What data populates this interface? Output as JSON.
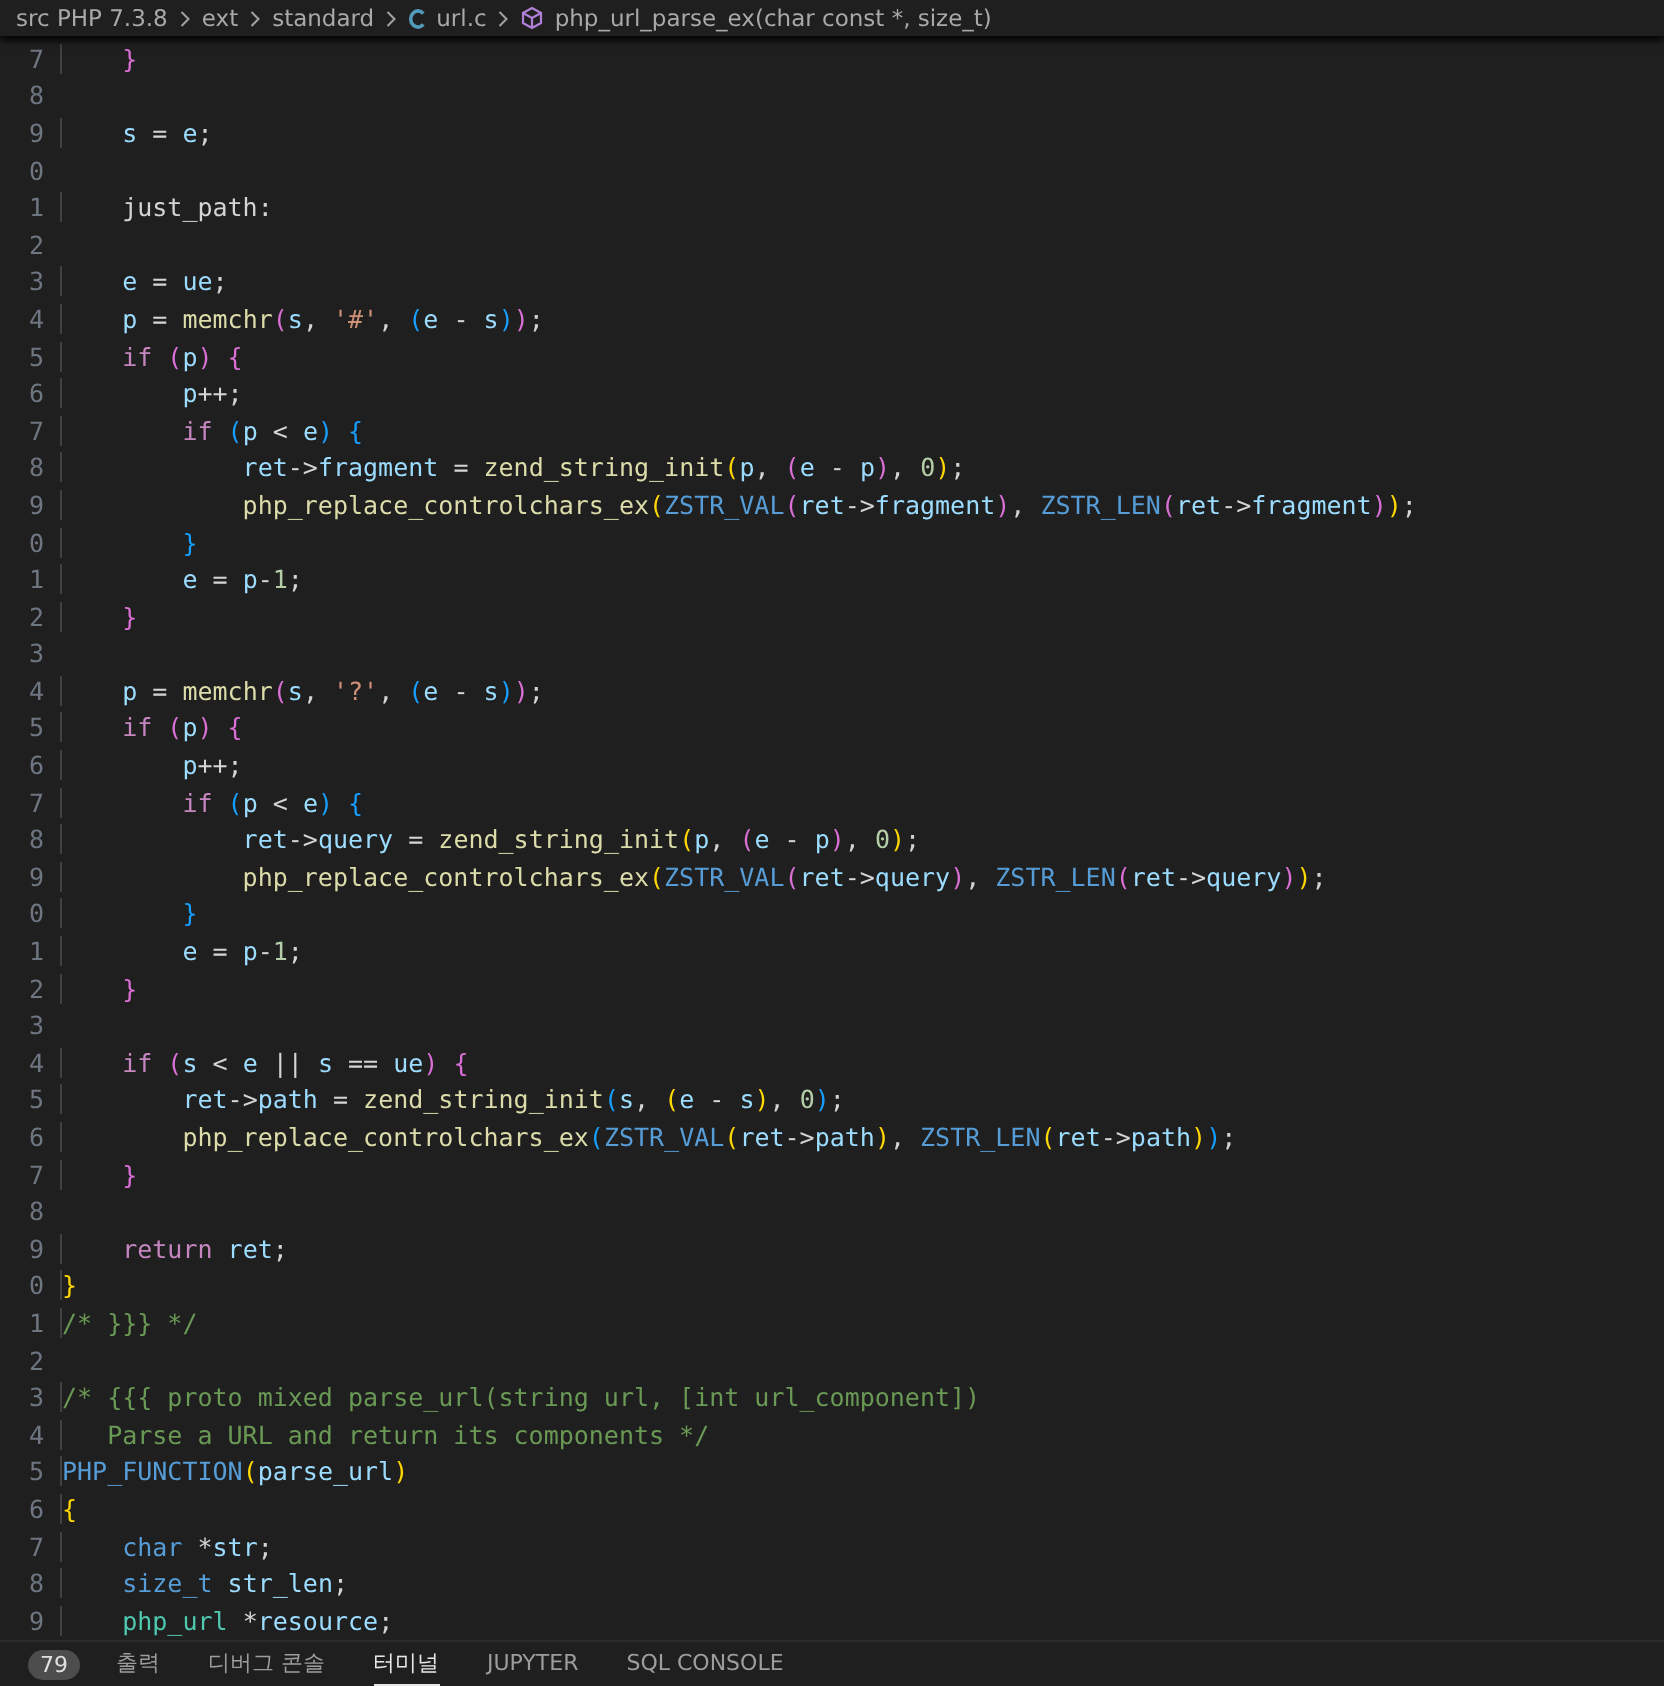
{
  "breadcrumb": [
    {
      "label": "src PHP 7.3.8"
    },
    {
      "label": "ext"
    },
    {
      "label": "standard"
    },
    {
      "label": "url.c"
    },
    {
      "label": "php_url_parse_ex(char const *, size_t)"
    }
  ],
  "editor": {
    "lines": [
      {
        "num": "7",
        "tokens": [
          {
            "kind": "b2",
            "text": "    }"
          }
        ]
      },
      {
        "num": "8"
      },
      {
        "num": "9",
        "tokens": [
          {
            "kind": "var",
            "text": "    s"
          },
          {
            "kind": "plain",
            "text": " = "
          },
          {
            "kind": "var",
            "text": "e"
          },
          {
            "kind": "plain",
            "text": ";"
          }
        ]
      },
      {
        "num": "0"
      },
      {
        "num": "1",
        "tokens": [
          {
            "kind": "plain",
            "text": "    just_path:"
          }
        ]
      },
      {
        "num": "2"
      },
      {
        "num": "3",
        "tokens": [
          {
            "kind": "var",
            "text": "    e"
          },
          {
            "kind": "plain",
            "text": " = "
          },
          {
            "kind": "var",
            "text": "ue"
          },
          {
            "kind": "plain",
            "text": ";"
          }
        ]
      },
      {
        "num": "4",
        "tokens": [
          {
            "kind": "var",
            "text": "    p"
          },
          {
            "kind": "plain",
            "text": " = "
          },
          {
            "kind": "fn",
            "text": "memchr"
          },
          {
            "kind": "b2",
            "text": "("
          },
          {
            "kind": "var",
            "text": "s"
          },
          {
            "kind": "plain",
            "text": ", "
          },
          {
            "kind": "str",
            "text": "'#'"
          },
          {
            "kind": "plain",
            "text": ", "
          },
          {
            "kind": "b3",
            "text": "("
          },
          {
            "kind": "var",
            "text": "e"
          },
          {
            "kind": "plain",
            "text": " - "
          },
          {
            "kind": "var",
            "text": "s"
          },
          {
            "kind": "b3",
            "text": ")"
          },
          {
            "kind": "b2",
            "text": ")"
          },
          {
            "kind": "plain",
            "text": ";"
          }
        ]
      },
      {
        "num": "5",
        "tokens": [
          {
            "kind": "kw",
            "text": "    if"
          },
          {
            "kind": "b2",
            "text": " ("
          },
          {
            "kind": "var",
            "text": "p"
          },
          {
            "kind": "b2",
            "text": ") {"
          }
        ]
      },
      {
        "num": "6",
        "tokens": [
          {
            "kind": "var",
            "text": "        p"
          },
          {
            "kind": "plain",
            "text": "++;"
          }
        ]
      },
      {
        "num": "7",
        "tokens": [
          {
            "kind": "kw",
            "text": "        if"
          },
          {
            "kind": "b3",
            "text": " ("
          },
          {
            "kind": "var",
            "text": "p"
          },
          {
            "kind": "plain",
            "text": " < "
          },
          {
            "kind": "var",
            "text": "e"
          },
          {
            "kind": "b3",
            "text": ") {"
          }
        ]
      },
      {
        "num": "8",
        "tokens": [
          {
            "kind": "var",
            "text": "            ret"
          },
          {
            "kind": "plain",
            "text": "->"
          },
          {
            "kind": "var",
            "text": "fragment"
          },
          {
            "kind": "plain",
            "text": " = "
          },
          {
            "kind": "fn",
            "text": "zend_string_init"
          },
          {
            "kind": "b1",
            "text": "("
          },
          {
            "kind": "var",
            "text": "p"
          },
          {
            "kind": "plain",
            "text": ", "
          },
          {
            "kind": "b2",
            "text": "("
          },
          {
            "kind": "var",
            "text": "e"
          },
          {
            "kind": "plain",
            "text": " - "
          },
          {
            "kind": "var",
            "text": "p"
          },
          {
            "kind": "b2",
            "text": ")"
          },
          {
            "kind": "plain",
            "text": ", "
          },
          {
            "kind": "num",
            "text": "0"
          },
          {
            "kind": "b1",
            "text": ")"
          },
          {
            "kind": "plain",
            "text": ";"
          }
        ]
      },
      {
        "num": "9",
        "tokens": [
          {
            "kind": "fn",
            "text": "            php_replace_controlchars_ex"
          },
          {
            "kind": "b1",
            "text": "("
          },
          {
            "kind": "macro",
            "text": "ZSTR_VAL"
          },
          {
            "kind": "b2",
            "text": "("
          },
          {
            "kind": "var",
            "text": "ret"
          },
          {
            "kind": "plain",
            "text": "->"
          },
          {
            "kind": "var",
            "text": "fragment"
          },
          {
            "kind": "b2",
            "text": ")"
          },
          {
            "kind": "plain",
            "text": ", "
          },
          {
            "kind": "macro",
            "text": "ZSTR_LEN"
          },
          {
            "kind": "b2",
            "text": "("
          },
          {
            "kind": "var",
            "text": "ret"
          },
          {
            "kind": "plain",
            "text": "->"
          },
          {
            "kind": "var",
            "text": "fragment"
          },
          {
            "kind": "b2",
            "text": ")"
          },
          {
            "kind": "b1",
            "text": ")"
          },
          {
            "kind": "plain",
            "text": ";"
          }
        ]
      },
      {
        "num": "0",
        "tokens": [
          {
            "kind": "b3",
            "text": "        }"
          }
        ]
      },
      {
        "num": "1",
        "tokens": [
          {
            "kind": "var",
            "text": "        e"
          },
          {
            "kind": "plain",
            "text": " = "
          },
          {
            "kind": "var",
            "text": "p"
          },
          {
            "kind": "plain",
            "text": "-"
          },
          {
            "kind": "num",
            "text": "1"
          },
          {
            "kind": "plain",
            "text": ";"
          }
        ]
      },
      {
        "num": "2",
        "tokens": [
          {
            "kind": "b2",
            "text": "    }"
          }
        ]
      },
      {
        "num": "3"
      },
      {
        "num": "4",
        "tokens": [
          {
            "kind": "var",
            "text": "    p"
          },
          {
            "kind": "plain",
            "text": " = "
          },
          {
            "kind": "fn",
            "text": "memchr"
          },
          {
            "kind": "b2",
            "text": "("
          },
          {
            "kind": "var",
            "text": "s"
          },
          {
            "kind": "plain",
            "text": ", "
          },
          {
            "kind": "str",
            "text": "'?'"
          },
          {
            "kind": "plain",
            "text": ", "
          },
          {
            "kind": "b3",
            "text": "("
          },
          {
            "kind": "var",
            "text": "e"
          },
          {
            "kind": "plain",
            "text": " - "
          },
          {
            "kind": "var",
            "text": "s"
          },
          {
            "kind": "b3",
            "text": ")"
          },
          {
            "kind": "b2",
            "text": ")"
          },
          {
            "kind": "plain",
            "text": ";"
          }
        ]
      },
      {
        "num": "5",
        "tokens": [
          {
            "kind": "kw",
            "text": "    if"
          },
          {
            "kind": "b2",
            "text": " ("
          },
          {
            "kind": "var",
            "text": "p"
          },
          {
            "kind": "b2",
            "text": ") {"
          }
        ]
      },
      {
        "num": "6",
        "tokens": [
          {
            "kind": "var",
            "text": "        p"
          },
          {
            "kind": "plain",
            "text": "++;"
          }
        ]
      },
      {
        "num": "7",
        "tokens": [
          {
            "kind": "kw",
            "text": "        if"
          },
          {
            "kind": "b3",
            "text": " ("
          },
          {
            "kind": "var",
            "text": "p"
          },
          {
            "kind": "plain",
            "text": " < "
          },
          {
            "kind": "var",
            "text": "e"
          },
          {
            "kind": "b3",
            "text": ") {"
          }
        ]
      },
      {
        "num": "8",
        "tokens": [
          {
            "kind": "var",
            "text": "            ret"
          },
          {
            "kind": "plain",
            "text": "->"
          },
          {
            "kind": "var",
            "text": "query"
          },
          {
            "kind": "plain",
            "text": " = "
          },
          {
            "kind": "fn",
            "text": "zend_string_init"
          },
          {
            "kind": "b1",
            "text": "("
          },
          {
            "kind": "var",
            "text": "p"
          },
          {
            "kind": "plain",
            "text": ", "
          },
          {
            "kind": "b2",
            "text": "("
          },
          {
            "kind": "var",
            "text": "e"
          },
          {
            "kind": "plain",
            "text": " - "
          },
          {
            "kind": "var",
            "text": "p"
          },
          {
            "kind": "b2",
            "text": ")"
          },
          {
            "kind": "plain",
            "text": ", "
          },
          {
            "kind": "num",
            "text": "0"
          },
          {
            "kind": "b1",
            "text": ")"
          },
          {
            "kind": "plain",
            "text": ";"
          }
        ]
      },
      {
        "num": "9",
        "tokens": [
          {
            "kind": "fn",
            "text": "            php_replace_controlchars_ex"
          },
          {
            "kind": "b1",
            "text": "("
          },
          {
            "kind": "macro",
            "text": "ZSTR_VAL"
          },
          {
            "kind": "b2",
            "text": "("
          },
          {
            "kind": "var",
            "text": "ret"
          },
          {
            "kind": "plain",
            "text": "->"
          },
          {
            "kind": "var",
            "text": "query"
          },
          {
            "kind": "b2",
            "text": ")"
          },
          {
            "kind": "plain",
            "text": ", "
          },
          {
            "kind": "macro",
            "text": "ZSTR_LEN"
          },
          {
            "kind": "b2",
            "text": "("
          },
          {
            "kind": "var",
            "text": "ret"
          },
          {
            "kind": "plain",
            "text": "->"
          },
          {
            "kind": "var",
            "text": "query"
          },
          {
            "kind": "b2",
            "text": ")"
          },
          {
            "kind": "b1",
            "text": ")"
          },
          {
            "kind": "plain",
            "text": ";"
          }
        ]
      },
      {
        "num": "0",
        "tokens": [
          {
            "kind": "b3",
            "text": "        }"
          }
        ]
      },
      {
        "num": "1",
        "tokens": [
          {
            "kind": "var",
            "text": "        e"
          },
          {
            "kind": "plain",
            "text": " = "
          },
          {
            "kind": "var",
            "text": "p"
          },
          {
            "kind": "plain",
            "text": "-"
          },
          {
            "kind": "num",
            "text": "1"
          },
          {
            "kind": "plain",
            "text": ";"
          }
        ]
      },
      {
        "num": "2",
        "tokens": [
          {
            "kind": "b2",
            "text": "    }"
          }
        ]
      },
      {
        "num": "3"
      },
      {
        "num": "4",
        "tokens": [
          {
            "kind": "kw",
            "text": "    if"
          },
          {
            "kind": "b2",
            "text": " ("
          },
          {
            "kind": "var",
            "text": "s"
          },
          {
            "kind": "plain",
            "text": " < "
          },
          {
            "kind": "var",
            "text": "e"
          },
          {
            "kind": "plain",
            "text": " || "
          },
          {
            "kind": "var",
            "text": "s"
          },
          {
            "kind": "plain",
            "text": " == "
          },
          {
            "kind": "var",
            "text": "ue"
          },
          {
            "kind": "b2",
            "text": ") {"
          }
        ]
      },
      {
        "num": "5",
        "tokens": [
          {
            "kind": "var",
            "text": "        ret"
          },
          {
            "kind": "plain",
            "text": "->"
          },
          {
            "kind": "var",
            "text": "path"
          },
          {
            "kind": "plain",
            "text": " = "
          },
          {
            "kind": "fn",
            "text": "zend_string_init"
          },
          {
            "kind": "b3",
            "text": "("
          },
          {
            "kind": "var",
            "text": "s"
          },
          {
            "kind": "plain",
            "text": ", "
          },
          {
            "kind": "b1",
            "text": "("
          },
          {
            "kind": "var",
            "text": "e"
          },
          {
            "kind": "plain",
            "text": " - "
          },
          {
            "kind": "var",
            "text": "s"
          },
          {
            "kind": "b1",
            "text": ")"
          },
          {
            "kind": "plain",
            "text": ", "
          },
          {
            "kind": "num",
            "text": "0"
          },
          {
            "kind": "b3",
            "text": ")"
          },
          {
            "kind": "plain",
            "text": ";"
          }
        ]
      },
      {
        "num": "6",
        "tokens": [
          {
            "kind": "fn",
            "text": "        php_replace_controlchars_ex"
          },
          {
            "kind": "b3",
            "text": "("
          },
          {
            "kind": "macro",
            "text": "ZSTR_VAL"
          },
          {
            "kind": "b1",
            "text": "("
          },
          {
            "kind": "var",
            "text": "ret"
          },
          {
            "kind": "plain",
            "text": "->"
          },
          {
            "kind": "var",
            "text": "path"
          },
          {
            "kind": "b1",
            "text": ")"
          },
          {
            "kind": "plain",
            "text": ", "
          },
          {
            "kind": "macro",
            "text": "ZSTR_LEN"
          },
          {
            "kind": "b1",
            "text": "("
          },
          {
            "kind": "var",
            "text": "ret"
          },
          {
            "kind": "plain",
            "text": "->"
          },
          {
            "kind": "var",
            "text": "path"
          },
          {
            "kind": "b1",
            "text": ")"
          },
          {
            "kind": "b3",
            "text": ")"
          },
          {
            "kind": "plain",
            "text": ";"
          }
        ]
      },
      {
        "num": "7",
        "tokens": [
          {
            "kind": "b2",
            "text": "    }"
          }
        ]
      },
      {
        "num": "8"
      },
      {
        "num": "9",
        "tokens": [
          {
            "kind": "kw",
            "text": "    return"
          },
          {
            "kind": "var",
            "text": " ret"
          },
          {
            "kind": "plain",
            "text": ";"
          }
        ]
      },
      {
        "num": "0",
        "tokens": [
          {
            "kind": "b1",
            "text": "}"
          }
        ]
      },
      {
        "num": "1",
        "tokens": [
          {
            "kind": "comment",
            "text": "/* }}} */"
          }
        ]
      },
      {
        "num": "2"
      },
      {
        "num": "3",
        "tokens": [
          {
            "kind": "comment",
            "text": "/* {{{ proto mixed parse_url(string url, [int url_component])"
          }
        ]
      },
      {
        "num": "4",
        "tokens": [
          {
            "kind": "comment",
            "text": "   Parse a URL and return its components */"
          }
        ]
      },
      {
        "num": "5",
        "tokens": [
          {
            "kind": "macro",
            "text": "PHP_FUNCTION"
          },
          {
            "kind": "b1",
            "text": "("
          },
          {
            "kind": "var",
            "text": "parse_url"
          },
          {
            "kind": "b1",
            "text": ")"
          }
        ]
      },
      {
        "num": "6",
        "tokens": [
          {
            "kind": "b1",
            "text": "{"
          }
        ]
      },
      {
        "num": "7",
        "tokens": [
          {
            "kind": "type",
            "text": "    char"
          },
          {
            "kind": "plain",
            "text": " *"
          },
          {
            "kind": "var",
            "text": "str"
          },
          {
            "kind": "plain",
            "text": ";"
          }
        ]
      },
      {
        "num": "8",
        "tokens": [
          {
            "kind": "type",
            "text": "    size_t"
          },
          {
            "kind": "var",
            "text": " str_len"
          },
          {
            "kind": "plain",
            "text": ";"
          }
        ]
      },
      {
        "num": "9",
        "tokens": [
          {
            "kind": "cls",
            "text": "    php_url"
          },
          {
            "kind": "plain",
            "text": " *"
          },
          {
            "kind": "var",
            "text": "resource"
          },
          {
            "kind": "plain",
            "text": ";"
          }
        ]
      }
    ]
  },
  "panel": {
    "problems_badge": "79",
    "tabs": [
      {
        "label": "출력",
        "selected": false
      },
      {
        "label": "디버그 콘솔",
        "selected": false
      },
      {
        "label": "터미널",
        "selected": true
      },
      {
        "label": "JUPYTER",
        "selected": false
      },
      {
        "label": "SQL CONSOLE",
        "selected": false
      }
    ]
  }
}
